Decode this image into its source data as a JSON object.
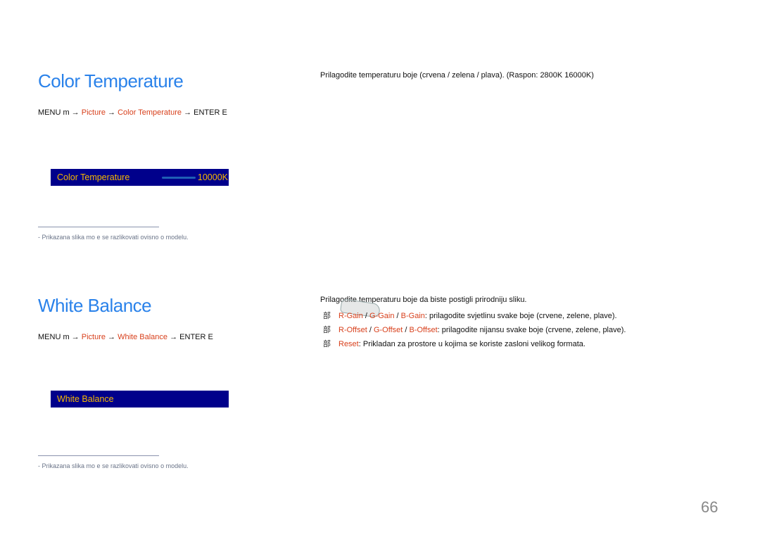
{
  "sections": [
    {
      "title": "Color Temperature",
      "path": {
        "menu": "MENU m",
        "arrow": "→",
        "item1": "Picture",
        "item2": "Color Temperature",
        "enter": "ENTER E"
      },
      "osd": {
        "label": "Color Temperature",
        "value": "10000K"
      },
      "note": "-   Prikazana slika mo e se razlikovati ovisno o modelu.",
      "description": "Prilagodite temperaturu boje (crvena / zelena / plava). (Raspon: 2800K 16000K)"
    },
    {
      "title": "White Balance",
      "path": {
        "menu": "MENU m",
        "arrow": "→",
        "item1": "Picture",
        "item2": "White Balance",
        "enter": "ENTER E"
      },
      "osd": {
        "label": "White Balance"
      },
      "note": "-   Prikazana slika mo e se razlikovati ovisno o modelu.",
      "description": "Prilagodite temperaturu boje da biste postigli prirodniju sliku.",
      "bullets": [
        {
          "marker": "部",
          "a": "R-Gain",
          "b": "G-Gain",
          "c": "B-Gain",
          "sep": " / ",
          "text": ": prilagodite svjetlinu svake boje (crvene, zelene, plave)."
        },
        {
          "marker": "部",
          "a": "R-Offset",
          "b": "G-Offset",
          "c": "B-Offset",
          "sep": " / ",
          "text": ": prilagodite nijansu svake boje (crvene, zelene, plave)."
        },
        {
          "marker": "部",
          "a": "Reset",
          "text": ": Prikladan za prostore u kojima se koriste zasloni velikog formata."
        }
      ]
    }
  ],
  "page_number": "66"
}
